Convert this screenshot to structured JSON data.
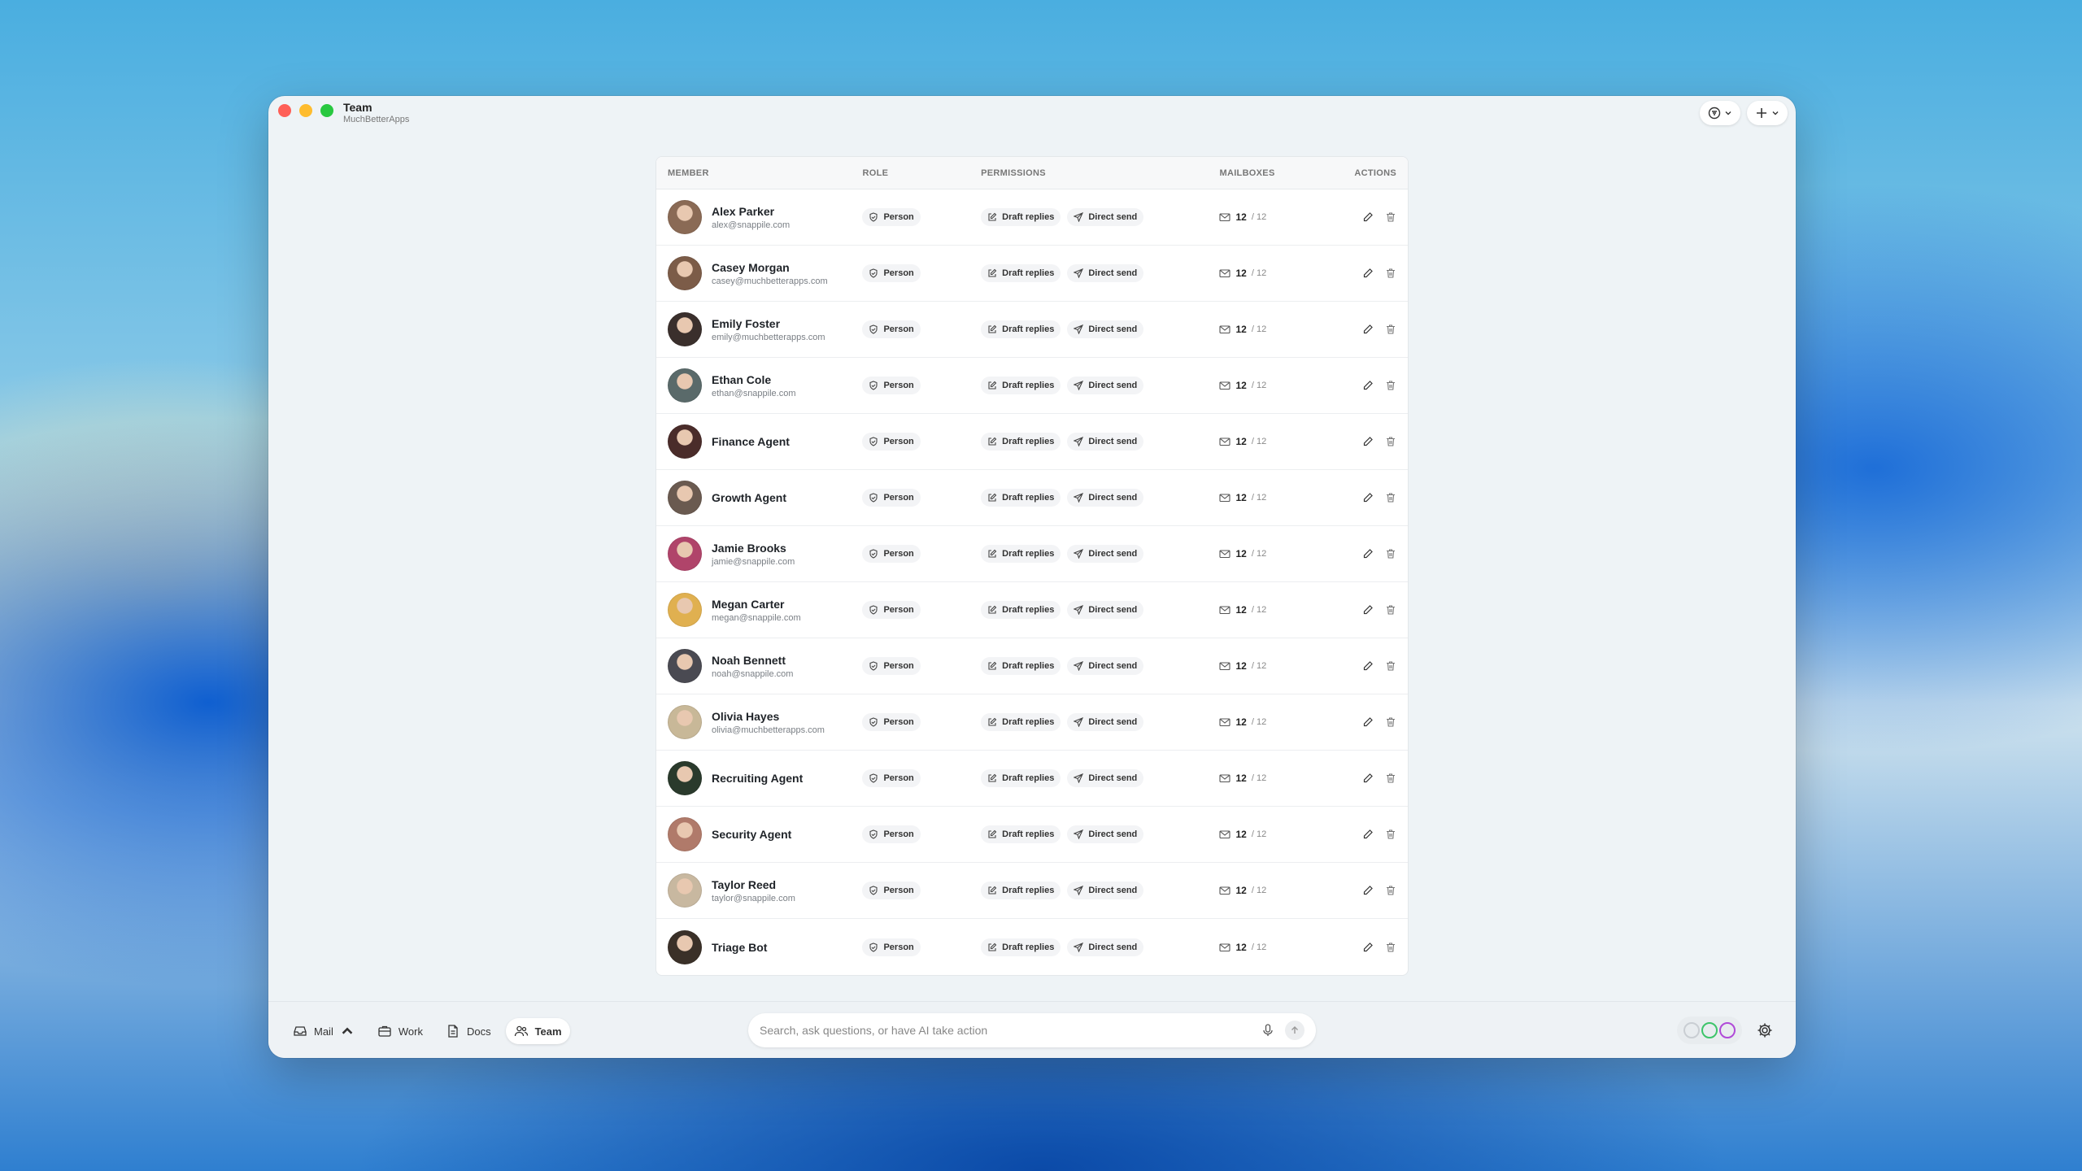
{
  "window": {
    "title": "Team",
    "subtitle": "MuchBetterApps"
  },
  "titlebar": {
    "filter_icon": "filter-icon",
    "add_icon": "plus-icon"
  },
  "table": {
    "headers": {
      "member": "MEMBER",
      "role": "ROLE",
      "permissions": "PERMISSIONS",
      "mailboxes": "MAILBOXES",
      "actions": "ACTIONS"
    },
    "rows": [
      {
        "name": "Alex Parker",
        "email": "alex@snappile.com",
        "role": "Person",
        "perm1": "Draft replies",
        "perm2": "Direct send",
        "mailboxes": "12",
        "total": "/ 12",
        "avatar_color": "#8a6a55"
      },
      {
        "name": "Casey Morgan",
        "email": "casey@muchbetterapps.com",
        "role": "Person",
        "perm1": "Draft replies",
        "perm2": "Direct send",
        "mailboxes": "12",
        "total": "/ 12",
        "avatar_color": "#7c5c48"
      },
      {
        "name": "Emily Foster",
        "email": "emily@muchbetterapps.com",
        "role": "Person",
        "perm1": "Draft replies",
        "perm2": "Direct send",
        "mailboxes": "12",
        "total": "/ 12",
        "avatar_color": "#3a2f2c"
      },
      {
        "name": "Ethan Cole",
        "email": "ethan@snappile.com",
        "role": "Person",
        "perm1": "Draft replies",
        "perm2": "Direct send",
        "mailboxes": "12",
        "total": "/ 12",
        "avatar_color": "#5a6a6a"
      },
      {
        "name": "Finance Agent",
        "email": "",
        "role": "Person",
        "perm1": "Draft replies",
        "perm2": "Direct send",
        "mailboxes": "12",
        "total": "/ 12",
        "avatar_color": "#4a2c2a"
      },
      {
        "name": "Growth Agent",
        "email": "",
        "role": "Person",
        "perm1": "Draft replies",
        "perm2": "Direct send",
        "mailboxes": "12",
        "total": "/ 12",
        "avatar_color": "#6a5a50"
      },
      {
        "name": "Jamie Brooks",
        "email": "jamie@snappile.com",
        "role": "Person",
        "perm1": "Draft replies",
        "perm2": "Direct send",
        "mailboxes": "12",
        "total": "/ 12",
        "avatar_color": "#b0446a"
      },
      {
        "name": "Megan Carter",
        "email": "megan@snappile.com",
        "role": "Person",
        "perm1": "Draft replies",
        "perm2": "Direct send",
        "mailboxes": "12",
        "total": "/ 12",
        "avatar_color": "#e0b050"
      },
      {
        "name": "Noah Bennett",
        "email": "noah@snappile.com",
        "role": "Person",
        "perm1": "Draft replies",
        "perm2": "Direct send",
        "mailboxes": "12",
        "total": "/ 12",
        "avatar_color": "#4a4a52"
      },
      {
        "name": "Olivia Hayes",
        "email": "olivia@muchbetterapps.com",
        "role": "Person",
        "perm1": "Draft replies",
        "perm2": "Direct send",
        "mailboxes": "12",
        "total": "/ 12",
        "avatar_color": "#c8b898"
      },
      {
        "name": "Recruiting Agent",
        "email": "",
        "role": "Person",
        "perm1": "Draft replies",
        "perm2": "Direct send",
        "mailboxes": "12",
        "total": "/ 12",
        "avatar_color": "#2a3a2c"
      },
      {
        "name": "Security Agent",
        "email": "",
        "role": "Person",
        "perm1": "Draft replies",
        "perm2": "Direct send",
        "mailboxes": "12",
        "total": "/ 12",
        "avatar_color": "#b07a6a"
      },
      {
        "name": "Taylor Reed",
        "email": "taylor@snappile.com",
        "role": "Person",
        "perm1": "Draft replies",
        "perm2": "Direct send",
        "mailboxes": "12",
        "total": "/ 12",
        "avatar_color": "#c8b8a0"
      },
      {
        "name": "Triage Bot",
        "email": "",
        "role": "Person",
        "perm1": "Draft replies",
        "perm2": "Direct send",
        "mailboxes": "12",
        "total": "/ 12",
        "avatar_color": "#3a3028"
      }
    ]
  },
  "bottombar": {
    "nav": [
      {
        "label": "Mail",
        "icon": "inbox-icon"
      },
      {
        "label": "Work",
        "icon": "briefcase-icon"
      },
      {
        "label": "Docs",
        "icon": "document-icon"
      },
      {
        "label": "Team",
        "icon": "users-icon",
        "active": true
      }
    ],
    "search_placeholder": "Search, ask questions, or have AI take action",
    "ring_colors": [
      "#c9ced3",
      "#3dc46a",
      "#b04ad8"
    ]
  }
}
